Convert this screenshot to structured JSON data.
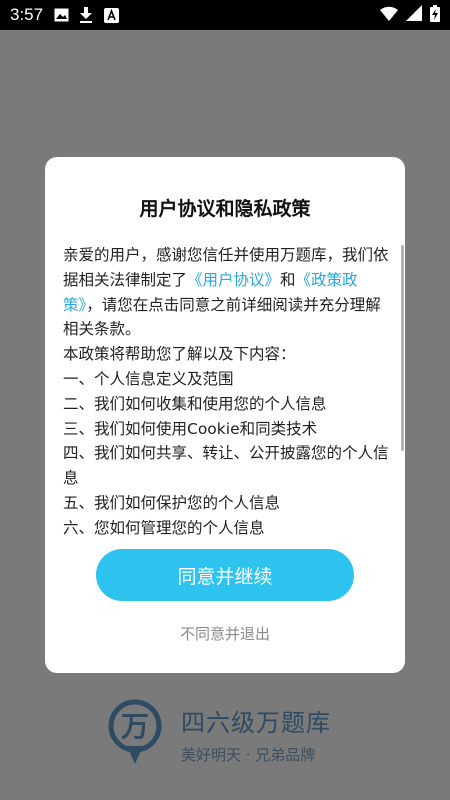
{
  "status_bar": {
    "time": "3:57",
    "left_icons": [
      "image-icon",
      "download-icon",
      "text-app-icon"
    ],
    "right_icons": [
      "wifi-icon",
      "signal-icon",
      "battery-charging-icon"
    ]
  },
  "background_brand": {
    "logo_char": "万",
    "title": "四六级万题库",
    "slogan": "美好明天 · 兄弟品牌"
  },
  "dialog": {
    "title": "用户协议和隐私政策",
    "intro_1": "亲爱的用户，感谢您信任并使用万题库，我们依据相关法律制定了",
    "link_user_agreement": "《用户协议》",
    "intro_and": "和",
    "link_policy": "《政策政策》",
    "intro_2": "，请您在点击同意之前详细阅读并充分理解相关条款。",
    "list_intro": "本政策将帮助您了解以及下内容：",
    "items": [
      "一、个人信息定义及范围",
      "二、我们如何收集和使用您的个人信息",
      "三、我们如何使用Cookie和同类技术",
      "四、我们如何共享、转让、公开披露您的个人信息",
      "五、我们如何保护您的个人信息",
      "六、您如何管理您的个人信息"
    ],
    "agree_button": "同意并继续",
    "reject_link": "不同意并退出"
  },
  "colors": {
    "accent": "#2ec2ef",
    "link": "#28a8e6",
    "overlay": "#7a7a7a"
  }
}
